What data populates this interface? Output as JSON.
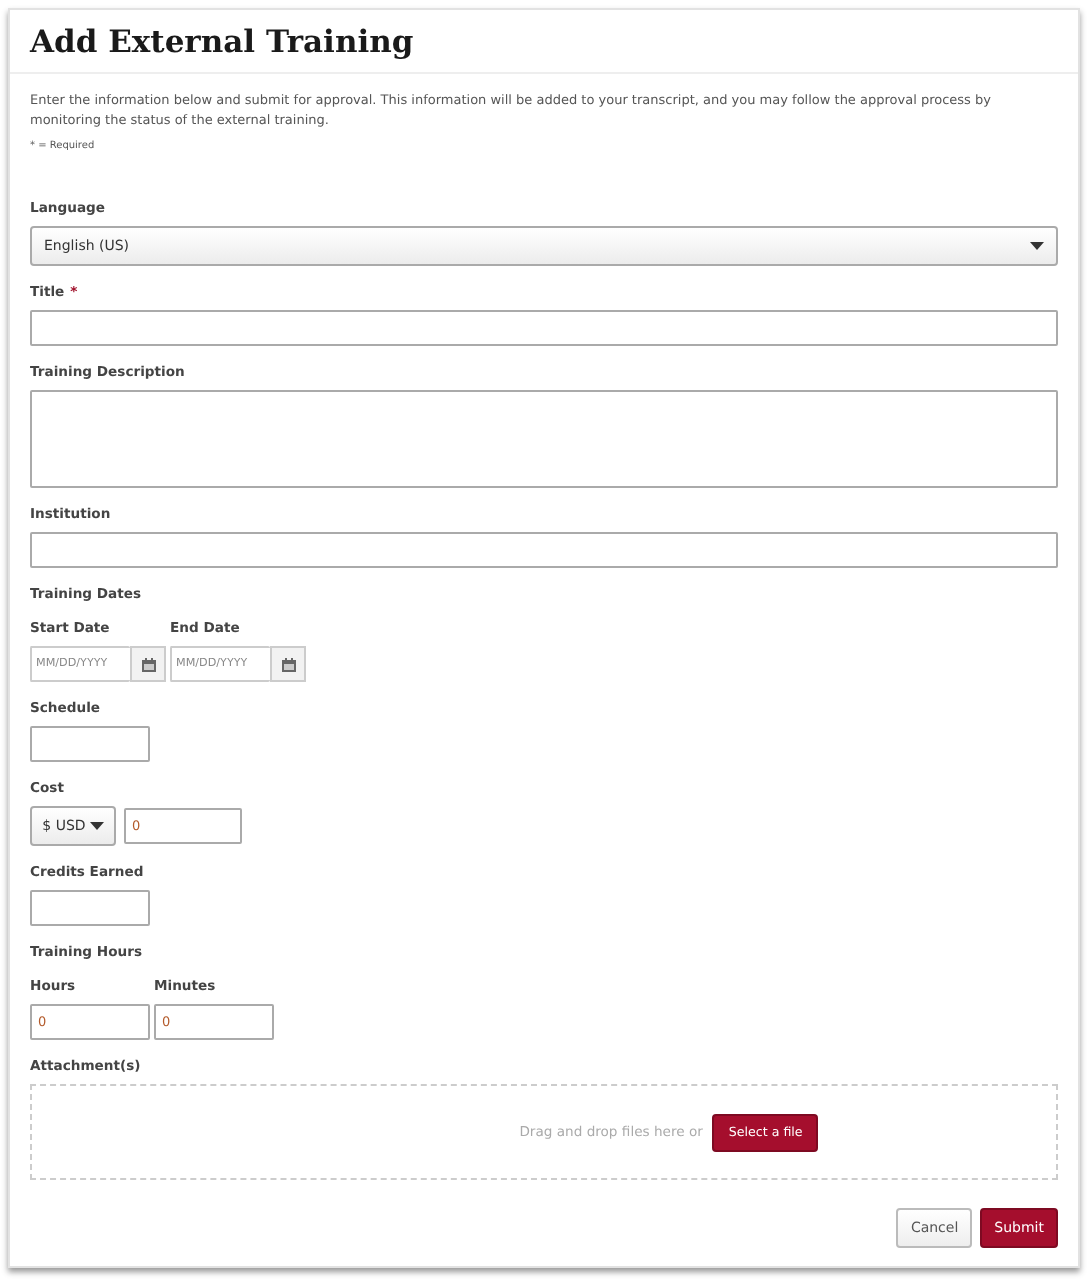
{
  "title": "Add External Training",
  "intro": "Enter the information below and submit for approval. This information will be added to your transcript, and you may follow the approval process by monitoring the status of the external training.",
  "required_note": "* = Required",
  "fields": [
    {
      "kind": "select",
      "label": "Language",
      "value": "English (US)"
    },
    {
      "kind": "text",
      "label": "Title",
      "required_mark": "*"
    },
    {
      "kind": "textarea",
      "label": "Training Description"
    },
    {
      "kind": "text",
      "label": "Institution"
    },
    {
      "kind": "group",
      "label": "Training Dates",
      "subfields": [
        {
          "kind": "date",
          "label": "Start Date",
          "placeholder": "MM/DD/YYYY"
        },
        {
          "kind": "date",
          "label": "End Date",
          "placeholder": "MM/DD/YYYY"
        }
      ]
    },
    {
      "kind": "short",
      "label": "Schedule"
    },
    {
      "kind": "currency",
      "label": "Cost",
      "currency": "$ USD",
      "value": "0"
    },
    {
      "kind": "short",
      "label": "Credits Earned"
    },
    {
      "kind": "group",
      "label": "Training Hours",
      "subfields": [
        {
          "kind": "short",
          "label": "Hours",
          "value": "0"
        },
        {
          "kind": "short",
          "label": "Minutes",
          "value": "0"
        }
      ]
    },
    {
      "kind": "upload",
      "label": "Attachment(s)",
      "hint": "Drag and drop files here or",
      "button": "Select a file"
    }
  ],
  "buttons": [
    {
      "label": "Cancel",
      "kind": "secondary"
    },
    {
      "label": "Submit",
      "kind": "primary"
    }
  ]
}
